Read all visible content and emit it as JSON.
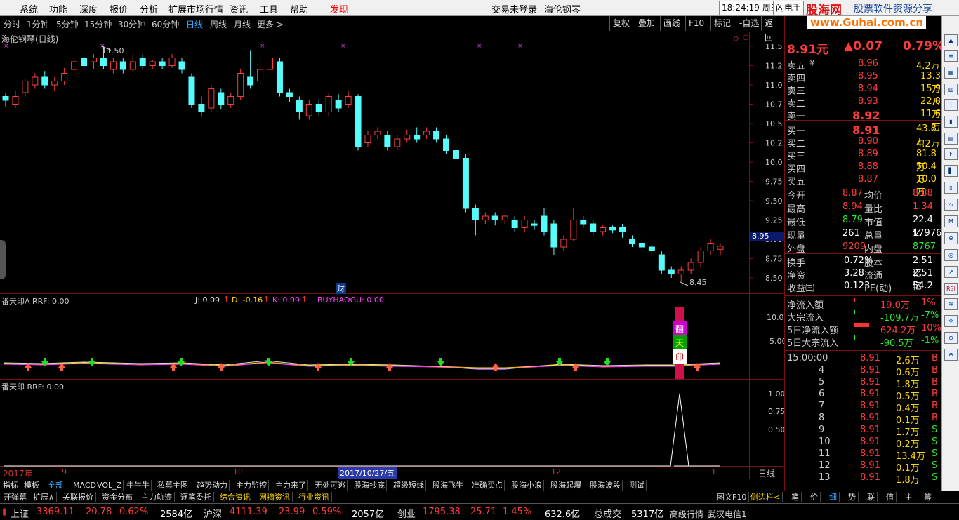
{
  "menu": {
    "items": [
      "系统",
      "功能",
      "深度",
      "报价",
      "分析",
      "扩展市场行情",
      "资讯",
      "工具",
      "帮助"
    ],
    "discover": "发现",
    "trade_status": "交易未登录",
    "stock_name": "海伦钢琴",
    "clock": "18:24:19 周三",
    "flash": "闪电手",
    "logo_main": "股海网",
    "logo_sub": "股票软件资源分享",
    "logo_url": "www.Guhai.com.cn"
  },
  "periods": [
    "分时",
    "1分钟",
    "5分钟",
    "15分钟",
    "30分钟",
    "60分钟",
    "日线",
    "周线",
    "月线",
    "更多 >"
  ],
  "active_period": "日线",
  "toolbar_right": [
    "复权",
    "叠加",
    "画线",
    "F10",
    "标记",
    "-自选",
    "返回"
  ],
  "chart": {
    "title": "海伦钢琴(日线)",
    "high_label": "11.50",
    "low_label": "8.45",
    "price_ticks": [
      "11.50",
      "11.25",
      "11.00",
      "10.75",
      "10.50",
      "10.25",
      "10.00",
      "9.75",
      "9.50",
      "9.25",
      "9.00",
      "8.75",
      "8.50"
    ],
    "current_price_box": "8.95",
    "cai_label": "财",
    "indicator1": {
      "name": "番天印A RRF: 0.00",
      "j": "J: 0.09",
      "d": "D: -0.16",
      "k": "K: 0.09",
      "buy": "BUYHAOGU: 0.00",
      "ticks": [
        "10.00",
        "5.00"
      ],
      "chars": [
        "翻",
        "天",
        "印"
      ]
    },
    "indicator2": {
      "name": "番天印 RRF: 0.00",
      "ticks": [
        "1.00",
        "0.75",
        "0.50"
      ]
    },
    "dates": {
      "year": "2017年",
      "m9": "9",
      "m10": "10",
      "sel": "2017/10/27/五",
      "m12": "12",
      "m1": "1"
    },
    "period_label": "日线",
    "zoom_buttons": [
      "+",
      "-",
      "0"
    ]
  },
  "quote": {
    "price": "8.91元",
    "change": "▲0.07",
    "pct": "0.79%",
    "sells": [
      {
        "label": "卖五",
        "mark": "¥",
        "price": "8.96",
        "vol": "4.2万"
      },
      {
        "label": "卖四",
        "mark": "",
        "price": "8.95",
        "vol": "13.3万"
      },
      {
        "label": "卖三",
        "mark": "",
        "price": "8.94",
        "vol": "15.9万"
      },
      {
        "label": "卖二",
        "mark": "",
        "price": "8.93",
        "vol": "22.8万"
      },
      {
        "label": "卖一",
        "mark": "",
        "price": "8.92",
        "vol": "11.6万"
      }
    ],
    "buys": [
      {
        "label": "买一",
        "price": "8.91",
        "vol": "43.8万"
      },
      {
        "label": "买二",
        "price": "8.90",
        "vol": "4.2万"
      },
      {
        "label": "买三",
        "price": "8.89",
        "vol": "81.8万"
      },
      {
        "label": "买四",
        "price": "8.88",
        "vol": "50.4万"
      },
      {
        "label": "买五",
        "price": "8.87",
        "vol": "10.0万"
      }
    ],
    "stats": [
      {
        "l1": "今开",
        "v1": "8.87",
        "c1": "red",
        "l2": "均价",
        "v2": "8.88",
        "c2": "red"
      },
      {
        "l1": "最高",
        "v1": "8.94",
        "c1": "red",
        "l2": "量比",
        "v2": "1.34",
        "c2": "red"
      },
      {
        "l1": "最低",
        "v1": "8.79",
        "c1": "grn",
        "l2": "市值",
        "v2": "22.4亿",
        "c2": "wht"
      },
      {
        "l1": "现量",
        "v1": "261",
        "c1": "wht",
        "l2": "总量",
        "v2": "17976",
        "c2": "wht"
      },
      {
        "l1": "外盘",
        "v1": "9209",
        "c1": "red",
        "l2": "内盘",
        "v2": "8767",
        "c2": "grn"
      }
    ],
    "stats2": [
      {
        "l1": "换手",
        "v1": "0.72%",
        "l2": "股本",
        "v2": "2.51亿"
      },
      {
        "l1": "净资",
        "v1": "3.28",
        "l2": "流通",
        "v2": "2.51亿"
      },
      {
        "l1": "收益㈢",
        "v1": "0.123",
        "l2": "PE(动)",
        "v2": "54.2"
      }
    ],
    "flows": [
      {
        "label": "净流入额",
        "val": "19.0万",
        "pct": "1%",
        "c": "red"
      },
      {
        "label": "大宗流入",
        "val": "-109.7万",
        "pct": "-7%",
        "c": "grn"
      },
      {
        "label": "5日净流入额",
        "val": "624.2万",
        "pct": "10%",
        "c": "red"
      },
      {
        "label": "5日大宗流入",
        "val": "-90.5万",
        "pct": "-1%",
        "c": "grn"
      }
    ],
    "ticks": [
      {
        "t": "15:00:00",
        "p": "8.91",
        "v": "2.6万",
        "s": "B"
      },
      {
        "t": "4",
        "p": "8.91",
        "v": "0.6万",
        "s": "B"
      },
      {
        "t": "5",
        "p": "8.91",
        "v": "1.8万",
        "s": "B"
      },
      {
        "t": "6",
        "p": "8.91",
        "v": "0.5万",
        "s": "B"
      },
      {
        "t": "7",
        "p": "8.91",
        "v": "0.4万",
        "s": "B"
      },
      {
        "t": "8",
        "p": "8.91",
        "v": "0.1万",
        "s": "B"
      },
      {
        "t": "9",
        "p": "8.91",
        "v": "1.7万",
        "s": "S"
      },
      {
        "t": "10",
        "p": "8.91",
        "v": "0.2万",
        "s": "S"
      },
      {
        "t": "11",
        "p": "8.91",
        "v": "13.4万",
        "s": "S"
      },
      {
        "t": "12",
        "p": "8.91",
        "v": "0.1万",
        "s": "S"
      },
      {
        "t": "13",
        "p": "8.91",
        "v": "1.8万",
        "s": "S"
      }
    ]
  },
  "tabs1": [
    "指标",
    "模板",
    "全部",
    "MACD",
    "VOL_Z",
    "牛牛牛",
    "私募主图",
    "趋势动力",
    "主力监控",
    "主力来了",
    "无处可逃",
    "股海抄底",
    "超级短线",
    "股海飞牛",
    "准确买点",
    "股海小浪",
    "股海起爆",
    "股海波段",
    "测试"
  ],
  "tabs2": [
    "开弹幕",
    "扩展∧",
    "关联报价",
    "资金分布",
    "主力轨迹",
    "逐笔委托",
    "综合资讯",
    "网摘资讯",
    "行业资讯"
  ],
  "tabs2_right": [
    "图文F10",
    "侧边栏<"
  ],
  "tabs2_right2": [
    "笔",
    "价",
    "细",
    "势",
    "联",
    "值",
    "主",
    "筹"
  ],
  "status": {
    "sh_name": "上证",
    "sh": "3369.11",
    "sh_chg": "20.78",
    "sh_pct": "0.62%",
    "sh_amt": "2584亿",
    "sz_name": "沪深",
    "sz": "4111.39",
    "sz_chg": "23.99",
    "sz_pct": "0.59%",
    "sz_amt": "2057亿",
    "cy_name": "创业",
    "cy": "1795.38",
    "cy_chg": "25.71",
    "cy_pct": "1.45%",
    "cy_amt": "632.6亿",
    "deal_label": "总成交",
    "deal": "5317亿",
    "server": "高级行情_武汉电信1"
  },
  "chart_data": {
    "type": "candlestick",
    "title": "海伦钢琴(日线)",
    "ylim": [
      8.4,
      11.6
    ],
    "candles": [
      [
        10.85,
        10.8,
        10.9,
        10.72
      ],
      [
        10.75,
        10.85,
        10.92,
        10.7
      ],
      [
        10.9,
        11.05,
        11.08,
        10.85
      ],
      [
        11.0,
        11.1,
        11.15,
        10.95
      ],
      [
        11.1,
        11.0,
        11.18,
        10.95
      ],
      [
        11.0,
        11.05,
        11.1,
        10.92
      ],
      [
        11.05,
        11.15,
        11.22,
        11.0
      ],
      [
        11.2,
        11.3,
        11.35,
        11.15
      ],
      [
        11.35,
        11.25,
        11.4,
        11.18
      ],
      [
        11.3,
        11.35,
        11.4,
        11.2
      ],
      [
        11.35,
        11.25,
        11.5,
        11.2
      ],
      [
        11.2,
        11.3,
        11.35,
        11.15
      ],
      [
        11.3,
        11.2,
        11.35,
        11.15
      ],
      [
        11.2,
        11.3,
        11.4,
        11.18
      ],
      [
        11.35,
        11.25,
        11.4,
        11.2
      ],
      [
        11.25,
        11.3,
        11.32,
        11.2
      ],
      [
        11.3,
        11.25,
        11.35,
        11.2
      ],
      [
        11.25,
        11.35,
        11.4,
        11.22
      ],
      [
        11.3,
        11.2,
        11.35,
        11.15
      ],
      [
        11.1,
        10.75,
        11.15,
        10.7
      ],
      [
        10.75,
        10.65,
        10.85,
        10.6
      ],
      [
        10.7,
        10.95,
        11.0,
        10.65
      ],
      [
        10.9,
        10.75,
        10.95,
        10.68
      ],
      [
        10.75,
        10.85,
        10.9,
        10.7
      ],
      [
        10.85,
        11.15,
        11.2,
        10.8
      ],
      [
        11.1,
        11.0,
        11.45,
        10.95
      ],
      [
        11.05,
        11.2,
        11.4,
        11.0
      ],
      [
        11.2,
        11.35,
        11.42,
        11.15
      ],
      [
        11.3,
        10.9,
        11.35,
        10.85
      ],
      [
        10.9,
        10.85,
        10.95,
        10.78
      ],
      [
        10.8,
        10.65,
        10.85,
        10.55
      ],
      [
        10.6,
        10.75,
        10.8,
        10.55
      ],
      [
        10.75,
        10.65,
        10.82,
        10.6
      ],
      [
        10.65,
        10.85,
        10.9,
        10.6
      ],
      [
        10.8,
        10.7,
        10.88,
        10.65
      ],
      [
        10.75,
        10.85,
        10.92,
        10.7
      ],
      [
        10.85,
        10.2,
        10.88,
        10.15
      ],
      [
        10.25,
        10.35,
        10.4,
        10.2
      ],
      [
        10.35,
        10.4,
        10.45,
        10.3
      ],
      [
        10.35,
        10.2,
        10.4,
        10.15
      ],
      [
        10.2,
        10.3,
        10.35,
        10.15
      ],
      [
        10.3,
        10.35,
        10.42,
        10.25
      ],
      [
        10.35,
        10.3,
        10.45,
        10.25
      ],
      [
        10.35,
        10.4,
        10.45,
        10.3
      ],
      [
        10.4,
        10.3,
        10.45,
        10.25
      ],
      [
        10.3,
        10.15,
        10.35,
        10.1
      ],
      [
        10.15,
        10.05,
        10.2,
        10.0
      ],
      [
        10.05,
        9.4,
        10.1,
        9.35
      ],
      [
        9.4,
        9.25,
        9.45,
        9.05
      ],
      [
        9.25,
        9.3,
        9.35,
        9.2
      ],
      [
        9.3,
        9.25,
        9.35,
        9.18
      ],
      [
        9.25,
        9.3,
        9.32,
        9.2
      ],
      [
        9.25,
        9.15,
        9.3,
        9.1
      ],
      [
        9.15,
        9.25,
        9.3,
        9.1
      ],
      [
        9.2,
        9.18,
        9.25,
        9.12
      ],
      [
        9.3,
        9.1,
        9.4,
        9.05
      ],
      [
        9.2,
        8.9,
        9.25,
        8.8
      ],
      [
        8.9,
        9.0,
        9.05,
        8.85
      ],
      [
        9.0,
        9.25,
        9.4,
        8.98
      ],
      [
        9.25,
        9.2,
        9.3,
        9.15
      ],
      [
        9.2,
        9.1,
        9.25,
        9.05
      ],
      [
        9.1,
        9.15,
        9.18,
        9.05
      ],
      [
        9.15,
        9.12,
        9.18,
        9.08
      ],
      [
        9.15,
        9.1,
        9.2,
        9.02
      ],
      [
        9.0,
        8.95,
        9.05,
        8.9
      ],
      [
        8.95,
        8.9,
        9.0,
        8.85
      ],
      [
        8.9,
        8.85,
        8.95,
        8.8
      ],
      [
        8.8,
        8.6,
        8.85,
        8.55
      ],
      [
        8.6,
        8.55,
        8.65,
        8.5
      ],
      [
        8.55,
        8.6,
        8.65,
        8.45
      ],
      [
        8.6,
        8.7,
        8.75,
        8.55
      ],
      [
        8.7,
        8.85,
        8.9,
        8.65
      ],
      [
        8.85,
        8.95,
        9.0,
        8.8
      ],
      [
        8.87,
        8.91,
        8.94,
        8.79
      ]
    ],
    "indicator2_peak": 1.0
  }
}
